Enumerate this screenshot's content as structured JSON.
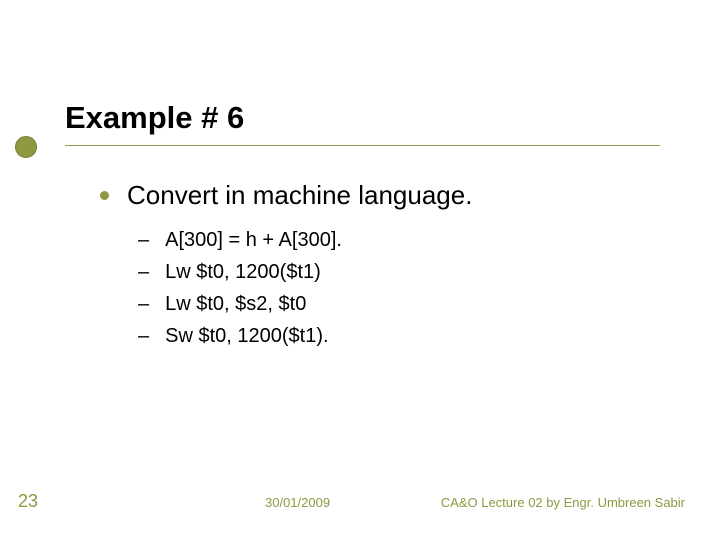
{
  "title": "Example # 6",
  "body": {
    "level1": "Convert in machine language.",
    "level2": [
      "A[300] = h + A[300].",
      "Lw $t0, 1200($t1)",
      "Lw $t0, $s2, $t0",
      "Sw $t0, 1200($t1)."
    ]
  },
  "footer": {
    "slide_number": "23",
    "date": "30/01/2009",
    "author": "CA&O Lecture 02 by Engr. Umbreen Sabir"
  },
  "colors": {
    "accent": "#8f983f"
  }
}
